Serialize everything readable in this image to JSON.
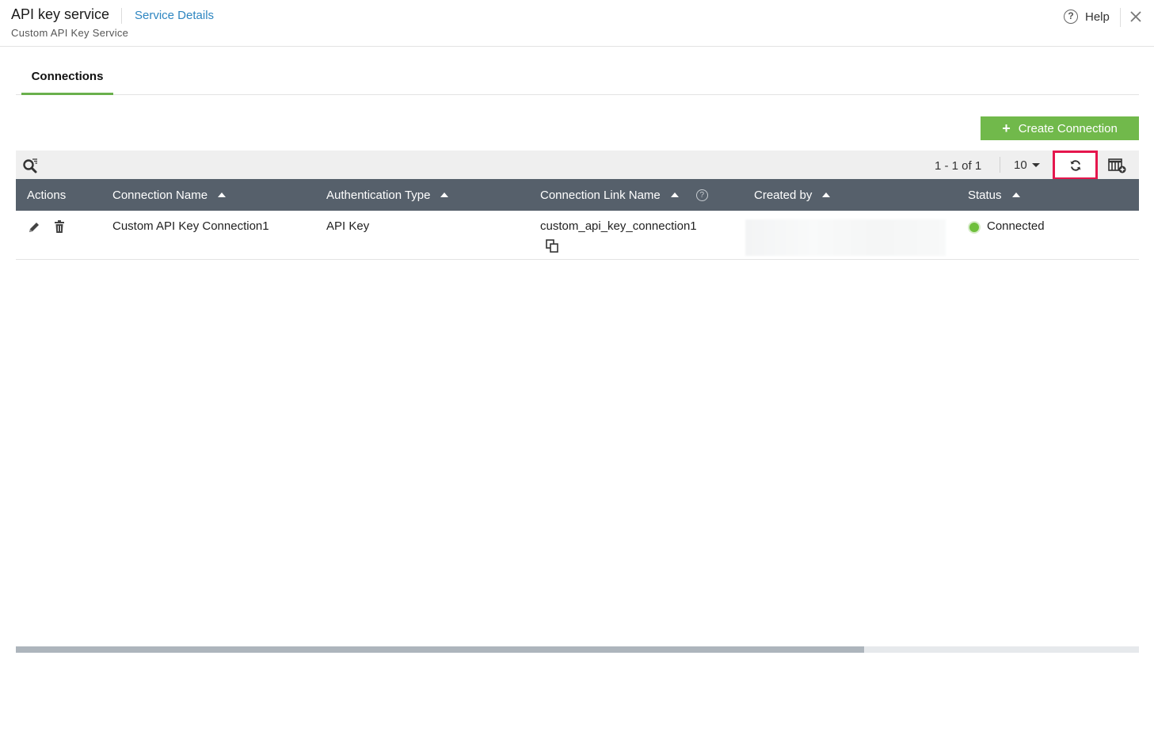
{
  "header": {
    "title": "API key service",
    "service_link": "Service Details",
    "subtitle": "Custom API Key Service",
    "help_label": "Help"
  },
  "tabs": [
    {
      "label": "Connections",
      "active": true
    }
  ],
  "toolbar": {
    "create_label": "Create Connection",
    "pager_text": "1 - 1 of 1",
    "page_size": "10"
  },
  "table": {
    "columns": [
      {
        "label": "Actions",
        "sortable": false
      },
      {
        "label": "Connection Name",
        "sortable": true,
        "sort": "asc"
      },
      {
        "label": "Authentication Type",
        "sortable": true,
        "sort": "asc"
      },
      {
        "label": "Connection Link Name",
        "sortable": true,
        "sort": "asc",
        "help_icon": true
      },
      {
        "label": "Created by",
        "sortable": true,
        "sort": "asc"
      },
      {
        "label": "Status",
        "sortable": true,
        "sort": "asc"
      }
    ],
    "rows": [
      {
        "connection_name": "Custom API Key Connection1",
        "auth_type": "API Key",
        "link_name": "custom_api_key_connection1",
        "created_by": "",
        "status": "Connected",
        "status_color": "#6fbf3c"
      }
    ]
  },
  "colors": {
    "accent_green": "#71b94b",
    "link_blue": "#2e86c1",
    "table_header_bg": "#56606b",
    "highlight_border": "#e5164d"
  },
  "icons": [
    "help-icon",
    "close-icon",
    "search-filter-icon",
    "plus-icon",
    "refresh-icon",
    "columns-add-icon",
    "pencil-icon",
    "trash-icon",
    "copy-icon",
    "status-dot-icon"
  ]
}
